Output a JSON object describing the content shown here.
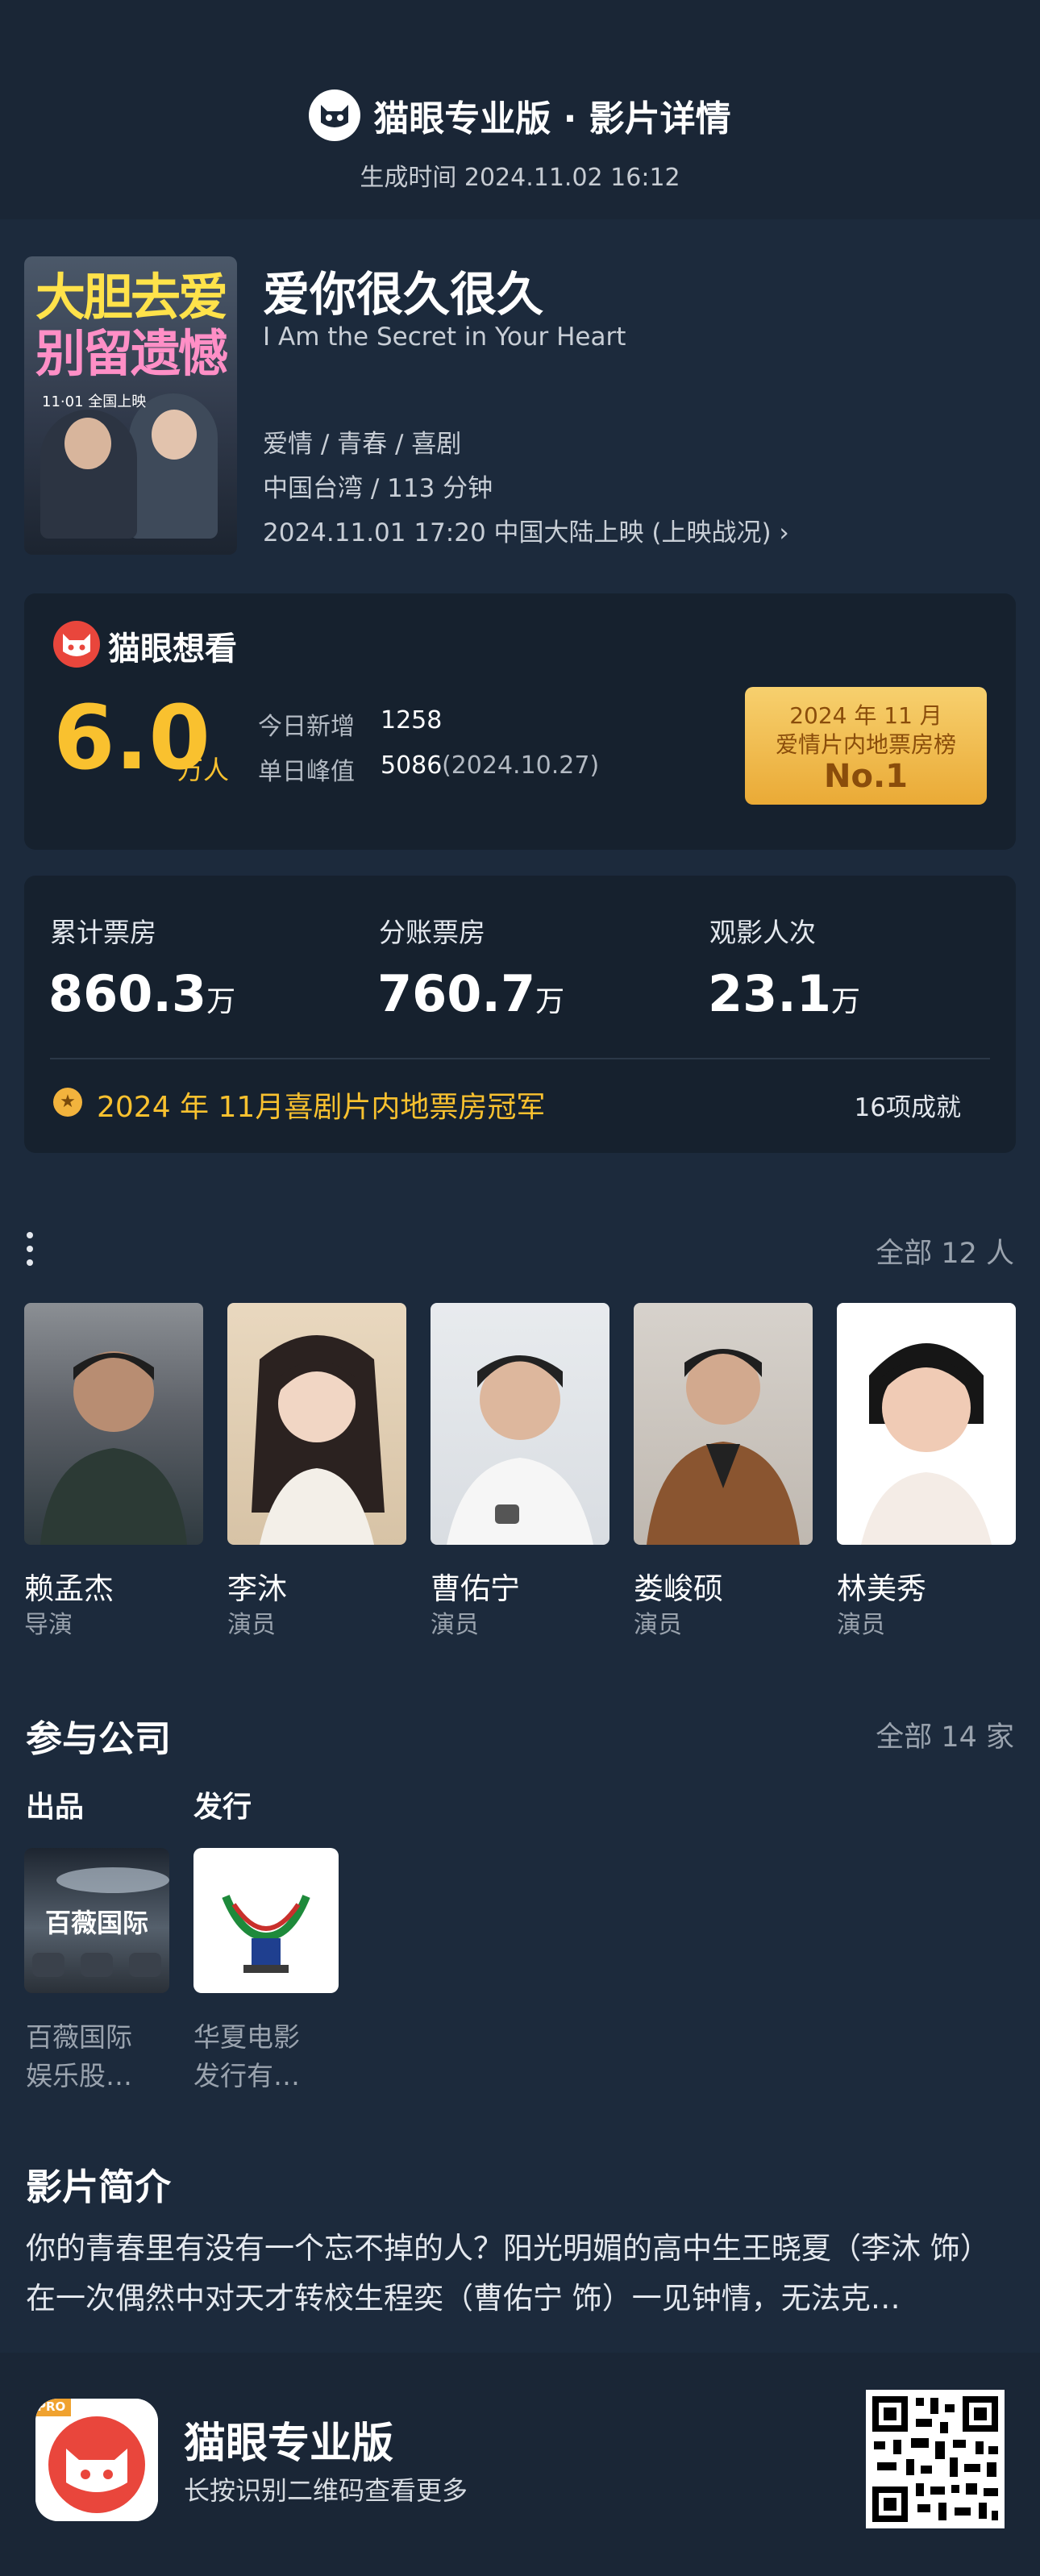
{
  "header": {
    "title": "猫眼专业版 · 影片详情",
    "generated": "生成时间 2024.11.02 16:12"
  },
  "movie": {
    "poster_text_1": "大胆去爱",
    "poster_text_2": "别留遗憾",
    "poster_date": "11·01 全国上映",
    "title": "爱你很久很久",
    "title_en": "I Am the Secret in Your Heart",
    "genres": "爱情 / 青春 / 喜剧",
    "region_duration": "中国台湾 / 113 分钟",
    "release": "2024.11.01 17:20 中国大陆上映 (上映战况) ›"
  },
  "want": {
    "title": "猫眼想看",
    "total": "6.0",
    "total_unit": "万人",
    "today_label": "今日新增",
    "today_value": "1258",
    "peak_label": "单日峰值",
    "peak_value": "5086",
    "peak_date": "(2024.10.27)",
    "rank_line1": "2024 年 11 月",
    "rank_line2": "爱情片内地票房榜",
    "rank_line3": "No.1"
  },
  "box_office": {
    "cumulative_label": "累计票房",
    "cumulative_value": "860.3",
    "split_label": "分账票房",
    "split_value": "760.7",
    "viewers_label": "观影人次",
    "viewers_value": "23.1",
    "unit": "万",
    "achievement": "2024 年 11月喜剧片内地票房冠军",
    "achievement_count": "16项成就"
  },
  "cast": {
    "more": "全部 12 人",
    "people": [
      {
        "name": "赖孟杰",
        "role": "导演"
      },
      {
        "name": "李沐",
        "role": "演员"
      },
      {
        "name": "曹佑宁",
        "role": "演员"
      },
      {
        "name": "娄峻硕",
        "role": "演员"
      },
      {
        "name": "林美秀",
        "role": "演员"
      }
    ]
  },
  "companies": {
    "title": "参与公司",
    "more": "全部 14 家",
    "producer_label": "出品",
    "distributor_label": "发行",
    "producer_logo_text": "百薇国际",
    "producer_name_1": "百薇国际",
    "producer_name_2": "娱乐股…",
    "distributor_name_1": "华夏电影",
    "distributor_name_2": "发行有…"
  },
  "synopsis": {
    "title": "影片简介",
    "text": "你的青春里有没有一个忘不掉的人？阳光明媚的高中生王晓夏（李沐 饰）在一次偶然中对天才转校生程奕（曹佑宁 饰）一见钟情，无法克…"
  },
  "footer": {
    "app_name": "猫眼专业版",
    "hint": "长按识别二维码查看更多",
    "pro_badge": "PRO"
  },
  "colors": {
    "background": "#1c2a3c",
    "card": "#16212e",
    "accent_yellow": "#f9c12f",
    "brand_red": "#e9463c"
  }
}
